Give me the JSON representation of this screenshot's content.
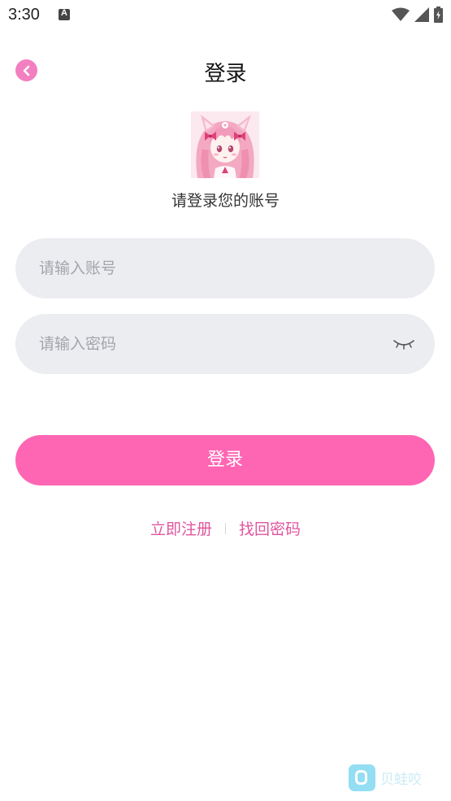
{
  "status_bar": {
    "time": "3:30"
  },
  "header": {
    "title": "登录"
  },
  "subtitle": "请登录您的账号",
  "form": {
    "account_placeholder": "请输入账号",
    "account_value": "",
    "password_placeholder": "请输入密码",
    "password_value": "",
    "login_label": "登录"
  },
  "links": {
    "register": "立即注册",
    "forgot_password": "找回密码"
  },
  "watermark": {
    "text": "贝蛙咬"
  },
  "colors": {
    "accent": "#fe66b3",
    "back_button": "#f27fc0",
    "link": "#e0559f",
    "input_bg": "#ecedf1"
  }
}
